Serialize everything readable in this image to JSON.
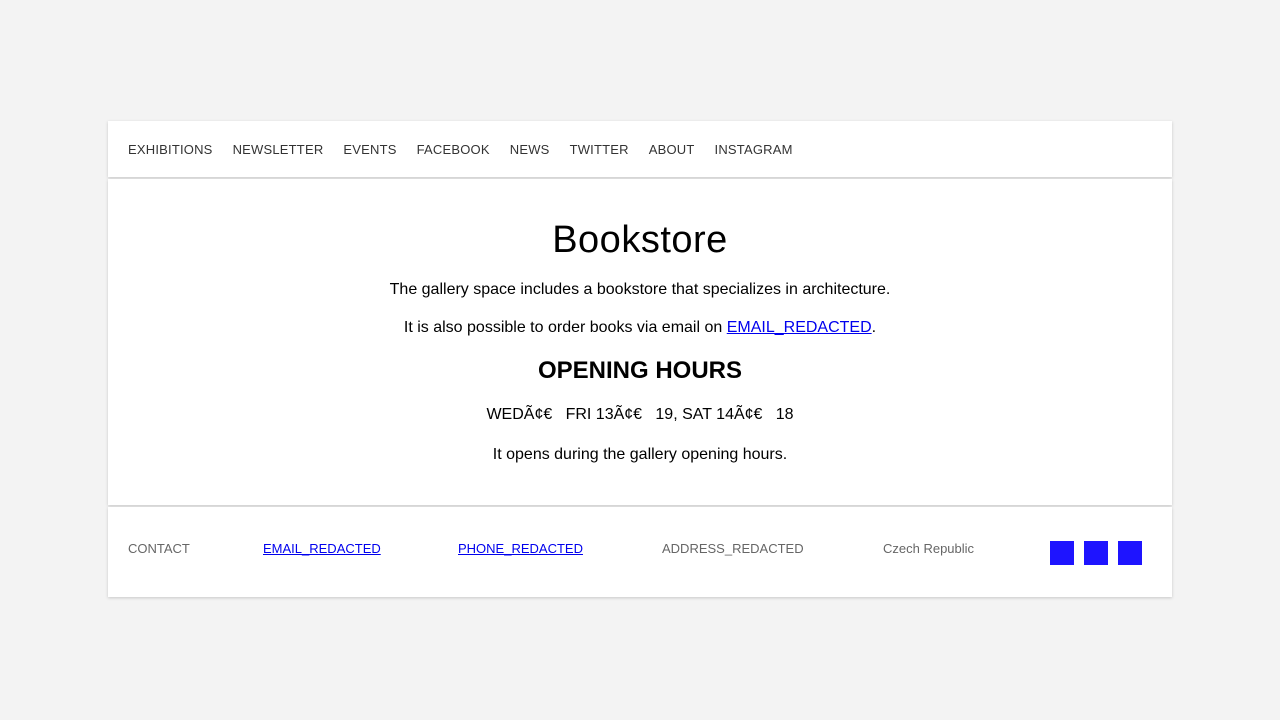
{
  "nav": {
    "items": [
      {
        "label": "EXHIBITIONS"
      },
      {
        "label": "NEWSLETTER"
      },
      {
        "label": "EVENTS"
      },
      {
        "label": "FACEBOOK"
      },
      {
        "label": "NEWS"
      },
      {
        "label": "TWITTER"
      },
      {
        "label": "ABOUT"
      },
      {
        "label": "INSTAGRAM"
      }
    ]
  },
  "main": {
    "title": "Bookstore",
    "intro": "The gallery space includes a bookstore that specializes in architecture.",
    "order_prefix": "It is also possible to order books via email on ",
    "order_email": "EMAIL_REDACTED",
    "order_suffix": ".",
    "hours_heading": "OPENING HOURS",
    "hours": "WEDÃ¢€ FRI 13Ã¢€ 19, SAT 14Ã¢€ 18",
    "note": "It opens during the gallery opening hours."
  },
  "footer": {
    "contact_label": "CONTACT",
    "email": "EMAIL_REDACTED",
    "phone": "PHONE_REDACTED",
    "address": "ADDRESS_REDACTED",
    "country": "Czech Republic",
    "social_icons": [
      "facebook-icon",
      "twitter-icon",
      "instagram-icon"
    ],
    "social_color": "#1e14ff"
  },
  "colors": {
    "background": "#f3f3f3",
    "panel": "#ffffff",
    "link": "#0000ee"
  }
}
